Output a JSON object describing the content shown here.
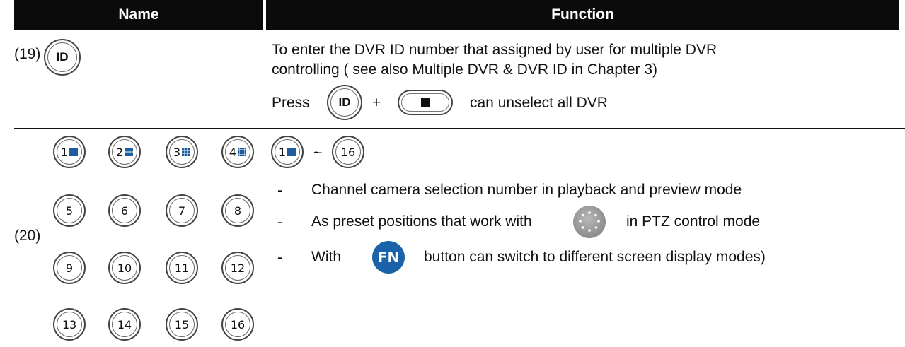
{
  "table": {
    "headers": {
      "name": "Name",
      "function": "Function"
    },
    "row19": {
      "number": "(19)",
      "id_button": "ID",
      "desc_line1": "To enter the DVR ID number that assigned by user for multiple DVR",
      "desc_line2": "controlling ( see also Multiple DVR & DVR ID in Chapter 3)",
      "press_label": "Press",
      "plus": "+",
      "press_suffix": "can unselect all DVR"
    },
    "row20": {
      "number": "(20)",
      "channel_buttons": [
        "1",
        "2",
        "3",
        "4",
        "5",
        "6",
        "7",
        "8",
        "9",
        "10",
        "11",
        "12",
        "13",
        "14",
        "15",
        "16"
      ],
      "range_start": "1",
      "range_sep": "~",
      "range_end": "16",
      "bullet": "-",
      "item1": "Channel camera selection number in playback and preview mode",
      "item2_prefix": "As preset positions that work with",
      "item2_suffix": "in PTZ control mode",
      "item3_prefix": "With",
      "fn_label": "FN",
      "item3_suffix": "button can switch to different screen display modes)"
    }
  },
  "icons": {
    "stop_button": "stop-square-icon",
    "ptz_button": "ptz-dial-icon",
    "split_icons": [
      "single-view-icon",
      "split-2-icon",
      "split-9-icon",
      "split-16-icon"
    ]
  },
  "colors": {
    "header_bg": "#0b0b0b",
    "fn_blue": "#1a63a8",
    "split_blue": "#1d5d9e"
  }
}
